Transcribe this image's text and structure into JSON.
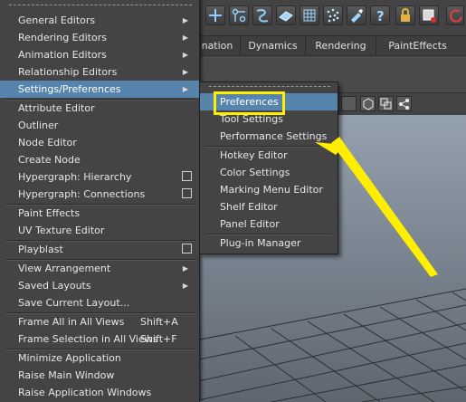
{
  "colors": {
    "menu_bg": "#444444",
    "menu_highlight": "#5784ac",
    "annotation_yellow": "#ffee00",
    "viewport_top": "#94a1ae",
    "viewport_bottom": "#5e6670"
  },
  "toolbar": {
    "icons": [
      "create-cube-icon",
      "move-tool-icon",
      "curve-tool-icon",
      "plane-icon",
      "lattice-icon",
      "particles-icon",
      "paint-tool-icon",
      "help-icon",
      "lock-icon",
      "render-view-icon",
      "undo-icon"
    ]
  },
  "tabs": [
    "nation",
    "Dynamics",
    "Rendering",
    "PaintEffects"
  ],
  "main_menu": {
    "items": [
      {
        "label": "General Editors",
        "submenu": true
      },
      {
        "label": "Rendering Editors",
        "submenu": true
      },
      {
        "label": "Animation Editors",
        "submenu": true
      },
      {
        "label": "Relationship Editors",
        "submenu": true
      },
      {
        "label": "Settings/Preferences",
        "submenu": true,
        "active": true
      },
      {
        "label": "Attribute Editor"
      },
      {
        "label": "Outliner"
      },
      {
        "label": "Node Editor"
      },
      {
        "label": "Create Node"
      },
      {
        "label": "Hypergraph: Hierarchy",
        "option_box": true
      },
      {
        "label": "Hypergraph: Connections",
        "option_box": true
      },
      {
        "label": "Paint Effects"
      },
      {
        "label": "UV Texture Editor"
      },
      {
        "label": "Playblast",
        "option_box": true
      },
      {
        "label": "View Arrangement",
        "submenu": true
      },
      {
        "label": "Saved Layouts",
        "submenu": true
      },
      {
        "label": "Save Current Layout..."
      },
      {
        "label": "Frame All in All Views",
        "shortcut": "Shift+A"
      },
      {
        "label": "Frame Selection in All Views",
        "shortcut": "Shift+F"
      },
      {
        "label": "Minimize Application"
      },
      {
        "label": "Raise Main Window"
      },
      {
        "label": "Raise Application Windows"
      }
    ]
  },
  "sub_menu": {
    "items": [
      {
        "label": "Preferences",
        "active": true
      },
      {
        "label": "Tool Settings"
      },
      {
        "label": "Performance Settings"
      },
      {
        "label": "Hotkey Editor"
      },
      {
        "label": "Color Settings"
      },
      {
        "label": "Marking Menu Editor"
      },
      {
        "label": "Shelf Editor"
      },
      {
        "label": "Panel Editor"
      },
      {
        "label": "Plug-in Manager"
      }
    ]
  }
}
